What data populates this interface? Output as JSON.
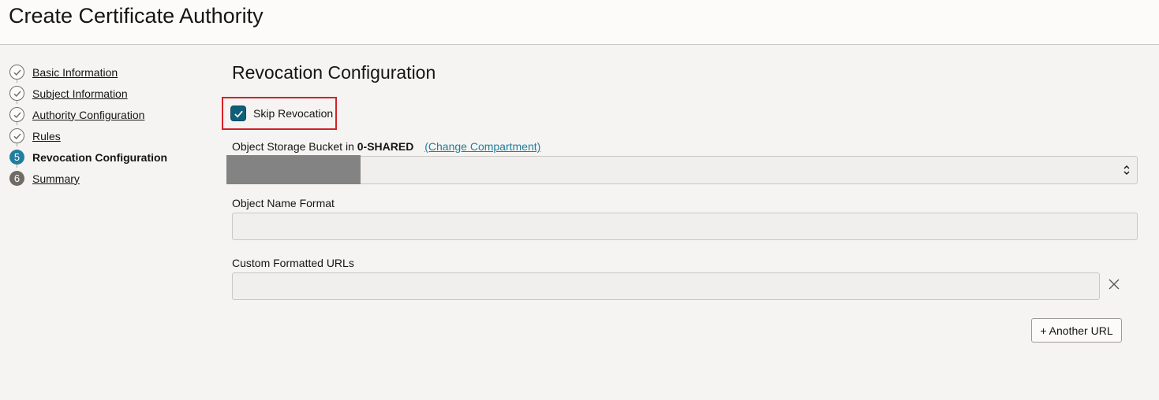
{
  "page_title": "Create Certificate Authority",
  "steps": [
    {
      "number": "1",
      "label": "Basic Information",
      "state": "done"
    },
    {
      "number": "2",
      "label": "Subject Information",
      "state": "done"
    },
    {
      "number": "3",
      "label": "Authority Configuration",
      "state": "done"
    },
    {
      "number": "4",
      "label": "Rules",
      "state": "done"
    },
    {
      "number": "5",
      "label": "Revocation Configuration",
      "state": "current"
    },
    {
      "number": "6",
      "label": "Summary",
      "state": "todo"
    }
  ],
  "section_title": "Revocation Configuration",
  "skip_revocation": {
    "label": "Skip Revocation",
    "checked": true
  },
  "bucket": {
    "label_prefix": "Object Storage Bucket in",
    "compartment": "0-SHARED",
    "change_link": "(Change Compartment)",
    "value": ""
  },
  "object_name_format": {
    "label": "Object Name Format",
    "value": ""
  },
  "custom_urls": {
    "label": "Custom Formatted URLs",
    "value": ""
  },
  "another_url_button": "+ Another URL",
  "colors": {
    "accent": "#227e9e",
    "checkbox": "#0f5f78",
    "highlight": "#d52027",
    "background": "#f5f4f2"
  }
}
